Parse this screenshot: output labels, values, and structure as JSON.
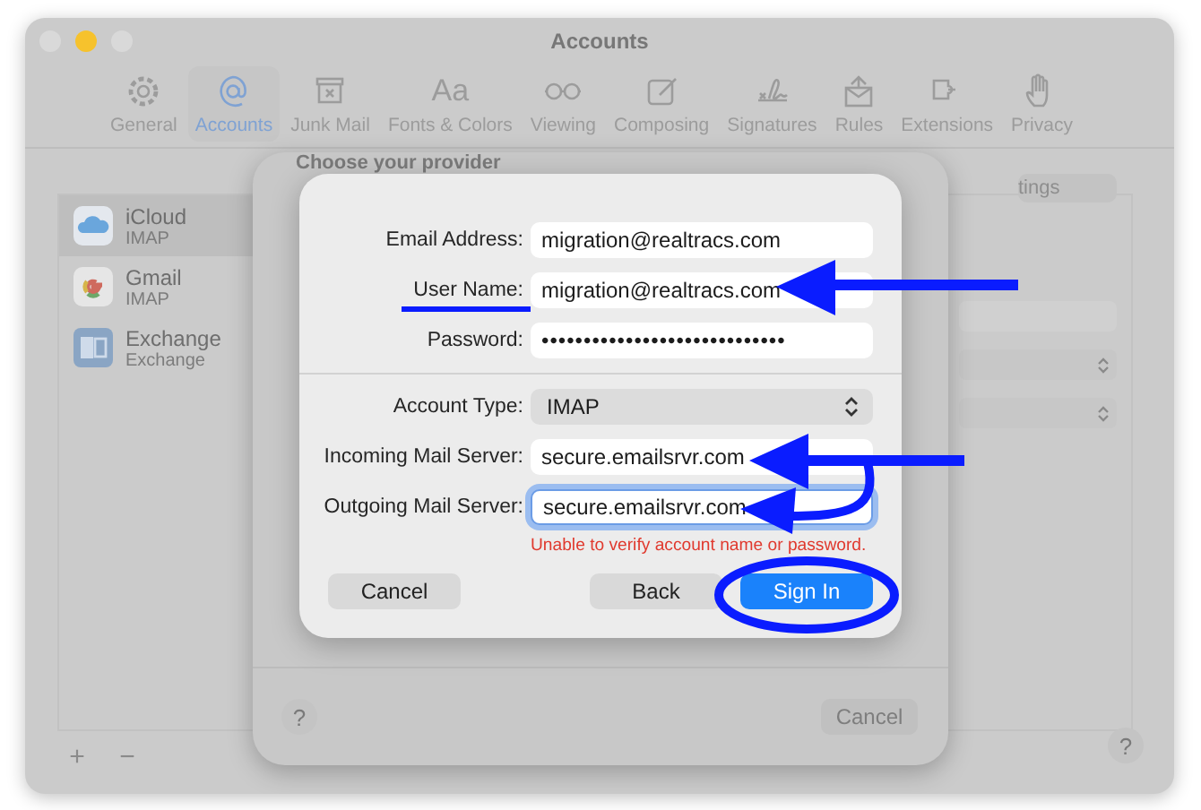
{
  "window": {
    "title": "Accounts"
  },
  "toolbar": [
    {
      "label": "General",
      "selected": false
    },
    {
      "label": "Accounts",
      "selected": true
    },
    {
      "label": "Junk Mail",
      "selected": false
    },
    {
      "label": "Fonts & Colors",
      "selected": false,
      "glyph": "Aa"
    },
    {
      "label": "Viewing",
      "selected": false
    },
    {
      "label": "Composing",
      "selected": false
    },
    {
      "label": "Signatures",
      "selected": false
    },
    {
      "label": "Rules",
      "selected": false
    },
    {
      "label": "Extensions",
      "selected": false
    },
    {
      "label": "Privacy",
      "selected": false
    }
  ],
  "accounts": [
    {
      "name": "iCloud",
      "type": "IMAP",
      "selected": true
    },
    {
      "name": "Gmail",
      "type": "IMAP",
      "selected": false
    },
    {
      "name": "Exchange",
      "type": "Exchange",
      "selected": false
    }
  ],
  "sidebar_buttons": [
    "+",
    "−"
  ],
  "help_button": "?",
  "background_tab": "tings",
  "sheet": {
    "heading": "Choose your provider",
    "help_button": "?",
    "cancel_button": "Cancel"
  },
  "dialog": {
    "fields": [
      {
        "kind": "text",
        "label": "Email Address:",
        "value": "migration@realtracs.com",
        "focused": false
      },
      {
        "kind": "text",
        "label": "User Name:",
        "value": "migration@realtracs.com",
        "focused": false
      },
      {
        "kind": "password",
        "label": "Password:",
        "value": "•••••••••••••••••••••••••••••",
        "focused": false
      },
      {
        "kind": "select",
        "label": "Account Type:",
        "value": "IMAP",
        "focused": false
      },
      {
        "kind": "text",
        "label": "Incoming Mail Server:",
        "value": "secure.emailsrvr.com",
        "focused": false
      },
      {
        "kind": "text",
        "label": "Outgoing Mail Server:",
        "value": "secure.emailsrvr.com",
        "focused": true
      }
    ],
    "error": "Unable to verify account name or password.",
    "buttons": [
      {
        "label": "Cancel",
        "kind": "default"
      },
      {
        "label": "Back",
        "kind": "default"
      },
      {
        "label": "Sign In",
        "kind": "primary"
      }
    ]
  }
}
